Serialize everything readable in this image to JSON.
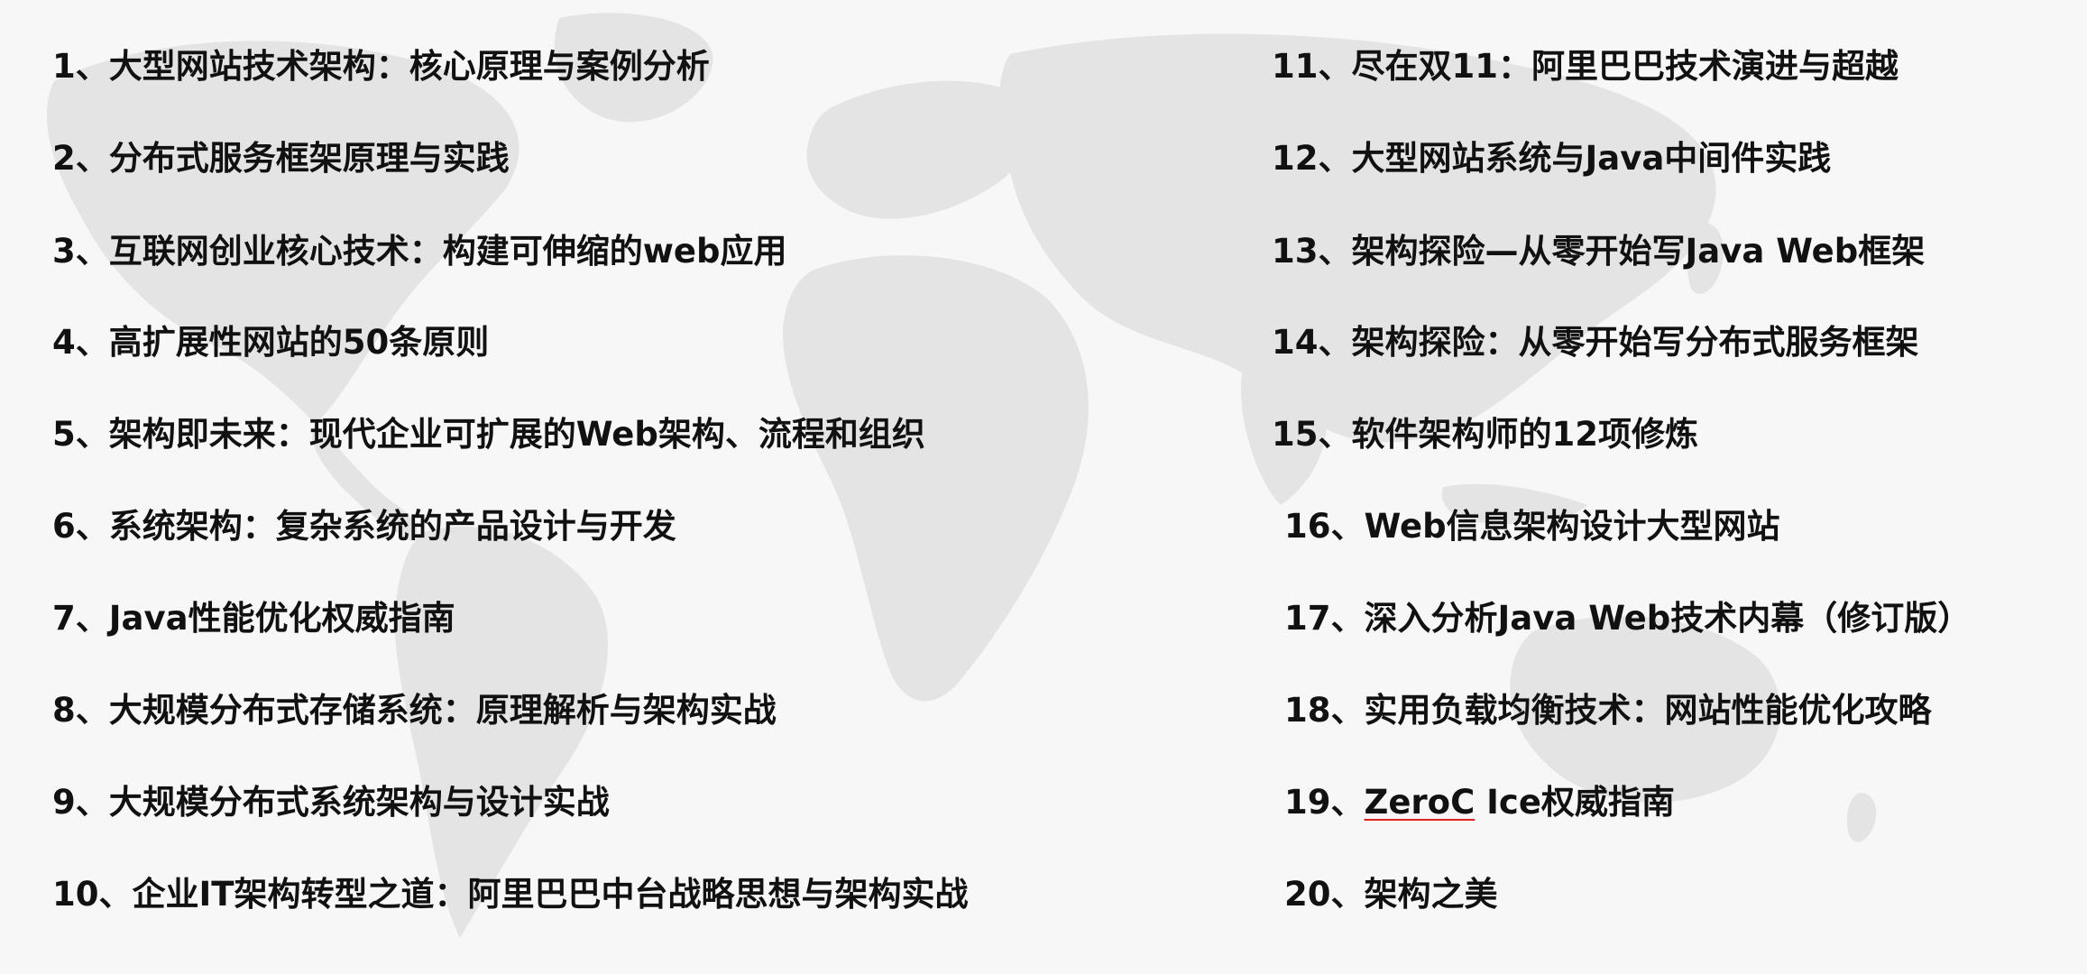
{
  "left_list": [
    {
      "text": "1、大型网站技术架构：核心原理与案例分析"
    },
    {
      "text": "2、分布式服务框架原理与实践"
    },
    {
      "text": "3、互联网创业核心技术：构建可伸缩的web应用"
    },
    {
      "text": "4、高扩展性网站的50条原则"
    },
    {
      "text": "5、架构即未来：现代企业可扩展的Web架构、流程和组织"
    },
    {
      "text": "6、系统架构：复杂系统的产品设计与开发"
    },
    {
      "text": "7、Java性能优化权威指南"
    },
    {
      "text": "8、大规模分布式存储系统：原理解析与架构实战"
    },
    {
      "text": "9、大规模分布式系统架构与设计实战"
    },
    {
      "text": "10、企业IT架构转型之道：阿里巴巴中台战略思想与架构实战"
    }
  ],
  "right_list": [
    {
      "text": "11、尽在双11：阿里巴巴技术演进与超越"
    },
    {
      "text": "12、大型网站系统与Java中间件实践"
    },
    {
      "text": "13、架构探险—从零开始写Java Web框架"
    },
    {
      "text": "14、架构探险：从零开始写分布式服务框架"
    },
    {
      "text": "15、软件架构师的12项修炼"
    },
    {
      "text": "16、Web信息架构设计大型网站"
    },
    {
      "text": "17、深入分析Java Web技术内幕（修订版）"
    },
    {
      "text": "18、实用负载均衡技术：网站性能优化攻略"
    },
    {
      "text": "19、",
      "underlined": "ZeroC",
      "rest": " Ice权威指南"
    },
    {
      "text": "20、架构之美"
    }
  ],
  "colors": {
    "background": "#f7f7f7",
    "text": "#111111",
    "map": "#e3e3e3",
    "spellcheck_underline": "#dd2222"
  }
}
